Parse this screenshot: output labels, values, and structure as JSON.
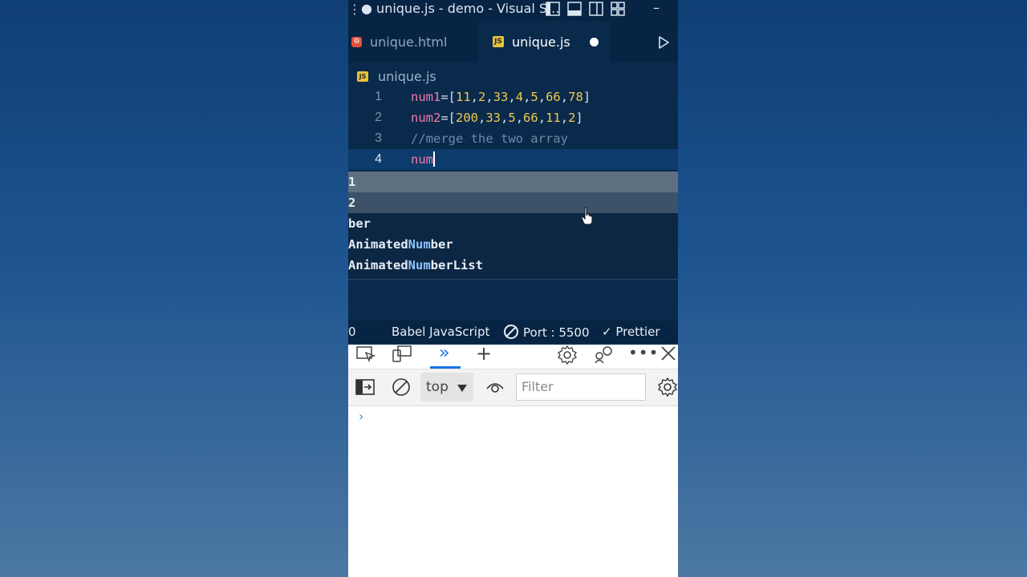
{
  "vscode": {
    "title": "● unique.js - demo - Visual S...",
    "tabs": [
      {
        "label": "unique.html",
        "icon": "html-file-icon"
      },
      {
        "label": "unique.js",
        "icon": "js-file-icon",
        "dirty": true
      }
    ],
    "breadcrumb": "unique.js",
    "code_lines": [
      {
        "number": "1",
        "text": "num1=[11,2,33,4,5,66,78]"
      },
      {
        "number": "2",
        "text": "num2=[200,33,5,66,11,2]"
      },
      {
        "number": "3",
        "text": "//merge the two array"
      },
      {
        "number": "4",
        "text": "num"
      }
    ],
    "suggestions": [
      {
        "prefix": "",
        "rest": "1"
      },
      {
        "prefix": "",
        "rest": "2"
      },
      {
        "prefix": "",
        "rest": "ber"
      },
      {
        "prefix": "Animated",
        "match": "Num",
        "rest": "ber"
      },
      {
        "prefix": "Animated",
        "match": "Num",
        "rest": "berList"
      }
    ],
    "statusbar": {
      "errors": "0",
      "language": "Babel JavaScript",
      "port": "Port : 5500",
      "prettier": "Prettier"
    }
  },
  "devtools": {
    "context": "top",
    "filter_placeholder": "Filter",
    "prompt": "›"
  },
  "colors": {
    "editor_bg": "#0a2a4c",
    "accent": "#1a73e8",
    "variable": "#f07aa8",
    "number": "#f2c94c"
  }
}
